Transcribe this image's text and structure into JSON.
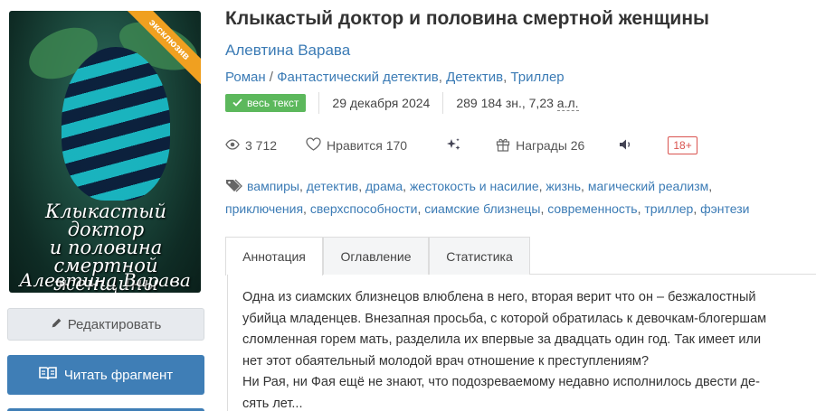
{
  "book": {
    "title": "Клыкастый доктор и половина смертной женщины",
    "author": "Алевтина Варава",
    "genres": [
      "Роман",
      "Фантастический детектив",
      "Детектив",
      "Триллер"
    ],
    "full_text_badge": "весь текст",
    "date": "29 декабря 2024",
    "size": "289 184 зн., 7,23",
    "size_unit": "а.л."
  },
  "cover": {
    "ribbon": "эксклюзив",
    "title_lines": [
      "Клыкастый доктор",
      "и половина",
      "смертной женщины"
    ],
    "author": "Алевтина Варава"
  },
  "stats": {
    "views": "3 712",
    "likes": "Нравится 170",
    "awards": "Награды 26",
    "age": "18+"
  },
  "tags": [
    "вампиры",
    "детектив",
    "драма",
    "жестокость и насилие",
    "жизнь",
    "магический реализм",
    "приключения",
    "сверхспособности",
    "сиамские близнецы",
    "современность",
    "триллер",
    "фэнтези"
  ],
  "buttons": {
    "edit": "Редактировать",
    "read": "Читать фрагмент"
  },
  "tabs": [
    "Аннотация",
    "Оглавление",
    "Статистика"
  ],
  "annotation": [
    "Одна из сиамских близнецов влюблена в него, вторая верит что он – безжалостный",
    "убийца младенцев. Внезапная просьба, с которой обратилась к девочкам-блогершам",
    "сломленная горем мать, разделила их впервые за двадцать один год. Так имеет или",
    "нет этот обаятельный молодой врач отношение к преступлениям?",
    "Ни Рая, ни Фая ещё не знают, что подозреваемому недавно исполнилось двести де-",
    "сять лет..."
  ],
  "colors": {
    "link": "#3b7bb5",
    "primary_button": "#3f7eb6",
    "badge_green": "#5cb85c",
    "age_red": "#d9534f",
    "ribbon": "#f0a020"
  }
}
